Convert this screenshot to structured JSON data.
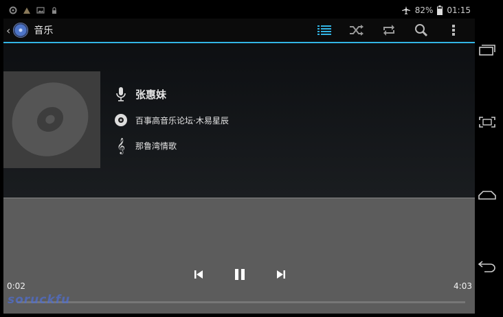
{
  "status_bar": {
    "battery": "82%",
    "time": "01:15"
  },
  "action_bar": {
    "title": "音乐"
  },
  "song": {
    "artist": "张惠妹",
    "album": "百事高音乐论坛·木易星辰",
    "track": "那鲁湾情歌"
  },
  "player": {
    "current_time": "0:02",
    "total_time": "4:03",
    "progress": 0.008
  },
  "watermark": "soruckfu",
  "colors": {
    "accent": "#33b5e5",
    "player_bg": "#5c5c5c",
    "art_bg": "#3d3d3d"
  }
}
